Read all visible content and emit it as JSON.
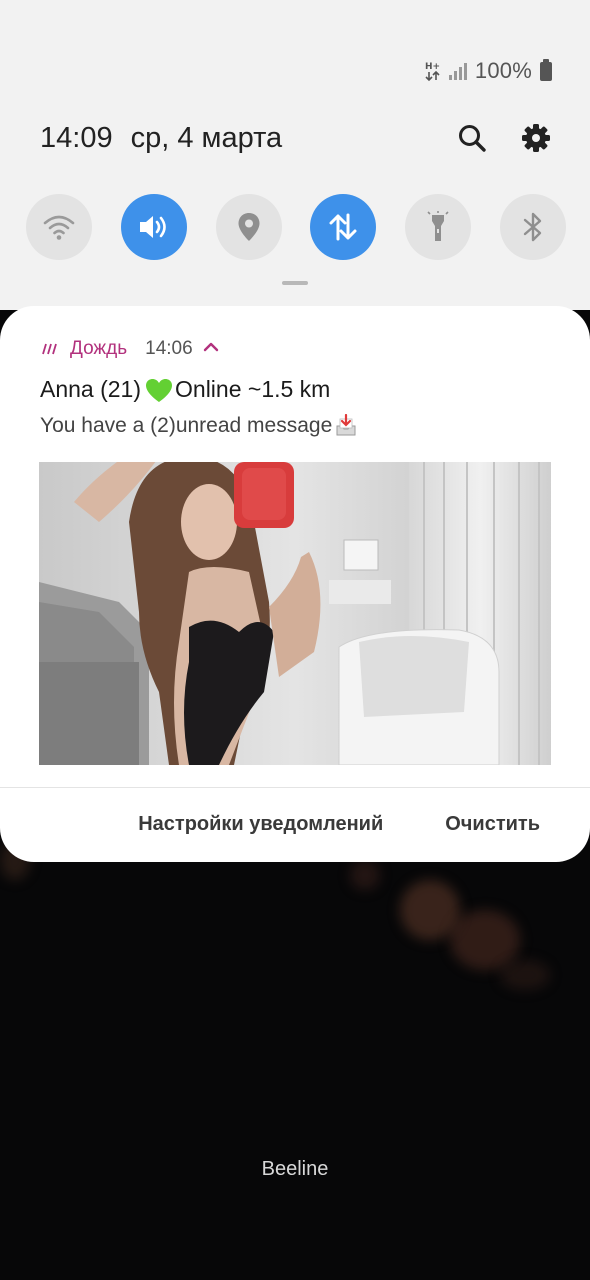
{
  "status_bar": {
    "battery_text": "100%",
    "icons": [
      "data-arrows-icon",
      "signal-bars-icon",
      "battery-icon"
    ]
  },
  "header": {
    "time": "14:09",
    "date": "ср, 4 марта",
    "icons": [
      "search-icon",
      "settings-gear-icon"
    ]
  },
  "quick_toggles": [
    {
      "name": "wifi",
      "icon": "wifi-icon",
      "active": false
    },
    {
      "name": "sound",
      "icon": "volume-icon",
      "active": true
    },
    {
      "name": "location",
      "icon": "location-pin-icon",
      "active": false
    },
    {
      "name": "mobile-data",
      "icon": "data-transfer-icon",
      "active": true
    },
    {
      "name": "flashlight",
      "icon": "flashlight-icon",
      "active": false
    },
    {
      "name": "bluetooth",
      "icon": "bluetooth-icon",
      "active": false
    }
  ],
  "notification": {
    "app_name": "Дождь",
    "time": "14:06",
    "title_name": "Anna (21)",
    "title_status": "Online ~1.5 km",
    "body": "You have a (2)unread message",
    "image_alt": "photo",
    "actions": {
      "settings_label": "Настройки уведомлений",
      "clear_label": "Очистить"
    },
    "accent_color": "#b2317d"
  },
  "lockscreen": {
    "carrier": "Beeline"
  },
  "colors": {
    "toggle_active": "#3e91ea",
    "toggle_inactive": "#e3e3e3",
    "panel_bg": "#f2f2f2"
  }
}
